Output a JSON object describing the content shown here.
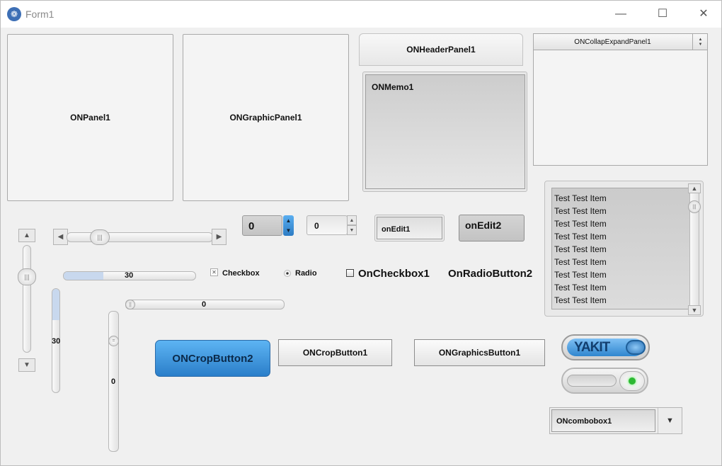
{
  "window": {
    "title": "Form1",
    "minimize_glyph": "—",
    "maximize_glyph": "☐",
    "close_glyph": "✕",
    "app_glyph": "❁"
  },
  "panels": {
    "panel1": "ONPanel1",
    "graphic_panel1": "ONGraphicPanel1",
    "header_panel1": "ONHeaderPanel1",
    "memo1": "ONMemo1",
    "collap_expand_panel1": "ONCollapExpandPanel1"
  },
  "spinners": {
    "spin1_value": "0",
    "spin2_value": "0"
  },
  "edits": {
    "edit1": "onEdit1",
    "edit2": "onEdit2"
  },
  "progress": {
    "horizontal_value": "30",
    "horizontal_level": 0.3,
    "vertical_value": "30",
    "vertical_level": 0.3
  },
  "sliders": {
    "horizontal_value": "0",
    "vertical_value": "0"
  },
  "checks": {
    "checkbox_label": "Checkbox",
    "radio_label": "Radio",
    "on_checkbox1": "OnCheckbox1",
    "on_radio_button2": "OnRadioButton2",
    "checkbox_glyph": "✕"
  },
  "buttons": {
    "crop_button2": "ONCropButton2",
    "crop_button1": "ONCropButton1",
    "graphics_button1": "ONGraphicsButton1"
  },
  "switch": {
    "yakit_label": "YAKIT"
  },
  "combobox": {
    "value": "ONcombobox1"
  },
  "listbox": {
    "items": [
      "Test Test Item",
      "Test Test Item",
      "Test Test Item",
      "Test Test Item",
      "Test Test Item",
      "Test Test Item",
      "Test Test Item",
      "Test Test Item",
      "Test Test Item"
    ]
  },
  "colors": {
    "accent": "#3a8fd8",
    "switch_on": "#2db833",
    "progress_fill": "#c8d8ee"
  }
}
